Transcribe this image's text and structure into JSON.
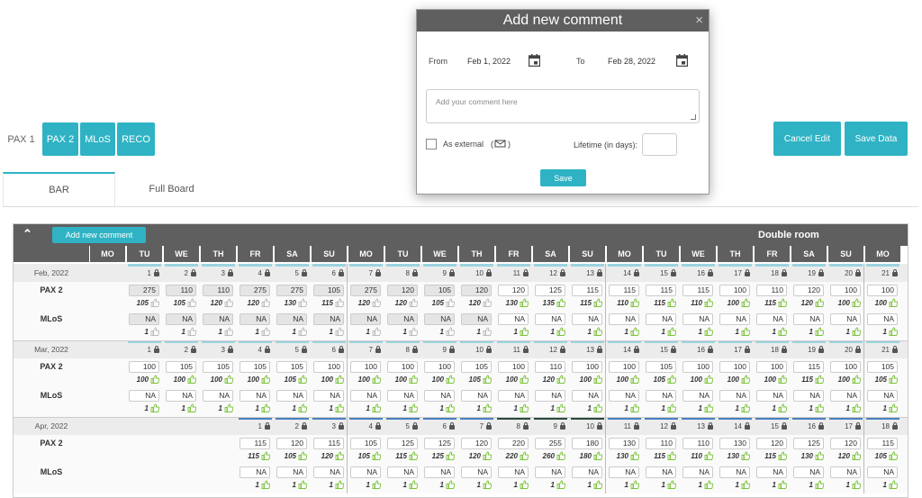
{
  "tabs": [
    {
      "label": "PAX 1",
      "active": true
    },
    {
      "label": "PAX 2",
      "active": false
    },
    {
      "label": "MLoS",
      "active": false
    },
    {
      "label": "RECO",
      "active": false
    }
  ],
  "actions": {
    "cancel": "Cancel Edit",
    "save": "Save Data"
  },
  "subtabs": [
    {
      "label": "BAR",
      "active": true
    },
    {
      "label": "Full Board",
      "active": false
    }
  ],
  "panel": {
    "add_comment": "Add new comment",
    "room": "Double room"
  },
  "day_headers": [
    "MO",
    "TU",
    "WE",
    "TH",
    "FR",
    "SA",
    "SU",
    "MO",
    "TU",
    "WE",
    "TH",
    "FR",
    "SA",
    "SU",
    "MO",
    "TU",
    "WE",
    "TH",
    "FR",
    "SA",
    "SU",
    "MO"
  ],
  "row_labels": {
    "pax": "PAX 2",
    "mlos": "MLoS"
  },
  "months": [
    {
      "label": "Feb, 2022",
      "dates": [
        "",
        "1",
        "2",
        "3",
        "4",
        "5",
        "6",
        "7",
        "8",
        "9",
        "10",
        "11",
        "12",
        "13",
        "14",
        "15",
        "16",
        "17",
        "18",
        "19",
        "20",
        "21"
      ],
      "bar": "light",
      "pax": [
        null,
        "275",
        "110",
        "110",
        "275",
        "275",
        "105",
        "275",
        "120",
        "105",
        "120",
        "120",
        "125",
        "115",
        "115",
        "115",
        "115",
        "100",
        "110",
        "120",
        "100",
        "100"
      ],
      "pax_sub": [
        null,
        "105",
        "105",
        "120",
        "120",
        "130",
        "115",
        "120",
        "120",
        "105",
        "120",
        "130",
        "135",
        "115",
        "110",
        "115",
        "110",
        "100",
        "115",
        "120",
        "100",
        "100"
      ],
      "pax_gray": [
        false,
        true,
        true,
        true,
        true,
        true,
        true,
        true,
        true,
        true,
        true,
        false,
        false,
        false,
        false,
        false,
        false,
        false,
        false,
        false,
        false,
        false
      ],
      "mlos": [
        null,
        "NA",
        "NA",
        "NA",
        "NA",
        "NA",
        "NA",
        "NA",
        "NA",
        "NA",
        "NA",
        "NA",
        "NA",
        "NA",
        "NA",
        "NA",
        "NA",
        "NA",
        "NA",
        "NA",
        "NA",
        "NA"
      ],
      "mlos_sub": [
        null,
        "1",
        "1",
        "1",
        "1",
        "1",
        "1",
        "1",
        "1",
        "1",
        "1",
        "1",
        "1",
        "1",
        "1",
        "1",
        "1",
        "1",
        "1",
        "1",
        "1",
        "1"
      ]
    },
    {
      "label": "Mar, 2022",
      "dates": [
        "",
        "1",
        "2",
        "3",
        "4",
        "5",
        "6",
        "7",
        "8",
        "9",
        "10",
        "11",
        "12",
        "13",
        "14",
        "15",
        "16",
        "17",
        "18",
        "19",
        "20",
        "21"
      ],
      "bar": "light",
      "pax": [
        null,
        "100",
        "105",
        "105",
        "105",
        "105",
        "100",
        "100",
        "100",
        "100",
        "105",
        "100",
        "110",
        "100",
        "100",
        "105",
        "100",
        "100",
        "100",
        "115",
        "100",
        "105"
      ],
      "pax_sub": [
        null,
        "100",
        "100",
        "100",
        "100",
        "105",
        "100",
        "100",
        "100",
        "100",
        "105",
        "100",
        "120",
        "100",
        "100",
        "105",
        "100",
        "100",
        "100",
        "115",
        "100",
        "105"
      ],
      "pax_gray": [
        false,
        false,
        false,
        false,
        false,
        false,
        false,
        false,
        false,
        false,
        false,
        false,
        false,
        false,
        false,
        false,
        false,
        false,
        false,
        false,
        false,
        false
      ],
      "mlos": [
        null,
        "NA",
        "NA",
        "NA",
        "NA",
        "NA",
        "NA",
        "NA",
        "NA",
        "NA",
        "NA",
        "NA",
        "NA",
        "NA",
        "NA",
        "NA",
        "NA",
        "NA",
        "NA",
        "NA",
        "NA",
        "NA"
      ],
      "mlos_sub": [
        null,
        "1",
        "1",
        "1",
        "1",
        "1",
        "1",
        "1",
        "1",
        "1",
        "1",
        "1",
        "1",
        "1",
        "1",
        "1",
        "1",
        "1",
        "1",
        "1",
        "1",
        "1"
      ]
    },
    {
      "label": "Apr, 2022",
      "dates": [
        "",
        "",
        "",
        "",
        "1",
        "2",
        "3",
        "4",
        "5",
        "6",
        "7",
        "8",
        "9",
        "10",
        "11",
        "12",
        "13",
        "14",
        "15",
        "16",
        "17",
        "18"
      ],
      "bar": "blue",
      "pax": [
        null,
        null,
        null,
        null,
        "115",
        "120",
        "115",
        "105",
        "125",
        "125",
        "120",
        "220",
        "255",
        "180",
        "130",
        "110",
        "110",
        "130",
        "120",
        "125",
        "120",
        "115"
      ],
      "pax_sub": [
        null,
        null,
        null,
        null,
        "115",
        "105",
        "120",
        "105",
        "115",
        "125",
        "120",
        "220",
        "260",
        "180",
        "130",
        "115",
        "110",
        "130",
        "115",
        "130",
        "120",
        "105"
      ],
      "pax_gray": [
        false,
        false,
        false,
        false,
        false,
        false,
        false,
        false,
        false,
        false,
        false,
        false,
        false,
        false,
        false,
        false,
        false,
        false,
        false,
        false,
        false,
        false
      ],
      "mlos": [
        null,
        null,
        null,
        null,
        "NA",
        "NA",
        "NA",
        "NA",
        "NA",
        "NA",
        "NA",
        "NA",
        "NA",
        "NA",
        "NA",
        "NA",
        "NA",
        "NA",
        "NA",
        "NA",
        "NA",
        "NA"
      ],
      "mlos_sub": [
        null,
        null,
        null,
        null,
        "1",
        "1",
        "1",
        "1",
        "1",
        "1",
        "1",
        "1",
        "1",
        "1",
        "1",
        "1",
        "1",
        "1",
        "1",
        "1",
        "1",
        "1"
      ]
    }
  ],
  "modal": {
    "title": "Add new comment",
    "close": "×",
    "from_label": "From",
    "from_date": "Feb 1, 2022",
    "to_label": "To",
    "to_date": "Feb 28, 2022",
    "comment_placeholder": "Add your comment here",
    "external_label": "As external",
    "lifetime_label": "Lifetime (in days):",
    "save": "Save"
  },
  "colors": {
    "accent": "#2fb3c4",
    "header": "#5f5f5f",
    "thumb_ok": "#7cc43a"
  }
}
